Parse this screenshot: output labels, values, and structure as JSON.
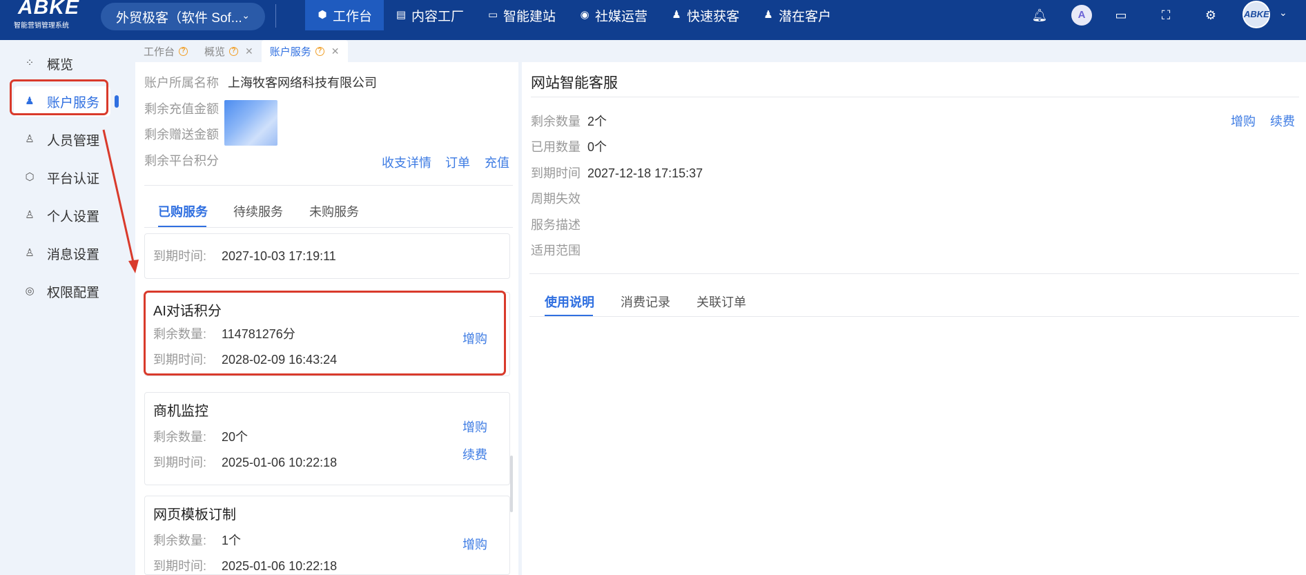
{
  "app": {
    "logo_text": "ABKE",
    "logo_sub": "智能营销管理系统",
    "org_selector": "外贸极客（软件 Sof...",
    "nav": [
      {
        "label": "工作台",
        "icon": "cube-icon",
        "active": true
      },
      {
        "label": "内容工厂",
        "icon": "document-icon"
      },
      {
        "label": "智能建站",
        "icon": "monitor-icon"
      },
      {
        "label": "社媒运营",
        "icon": "chat-bubble-icon"
      },
      {
        "label": "快速获客",
        "icon": "user-icon"
      },
      {
        "label": "潜在客户",
        "icon": "user-plus-icon"
      }
    ],
    "top_icons": [
      "bell-icon",
      "brand-a-icon",
      "folder-icon",
      "fullscreen-icon",
      "gear-icon"
    ],
    "avatar_text": "ABKE"
  },
  "sidebar": {
    "items": [
      {
        "label": "概览",
        "icon": "grid-icon"
      },
      {
        "label": "账户服务",
        "icon": "account-icon",
        "active": true
      },
      {
        "label": "人员管理",
        "icon": "people-icon"
      },
      {
        "label": "平台认证",
        "icon": "verify-icon"
      },
      {
        "label": "个人设置",
        "icon": "user-gear-icon"
      },
      {
        "label": "消息设置",
        "icon": "message-gear-icon"
      },
      {
        "label": "权限配置",
        "icon": "permission-icon"
      }
    ]
  },
  "page_tabs": [
    {
      "label": "工作台",
      "closable": false
    },
    {
      "label": "概览",
      "closable": true
    },
    {
      "label": "账户服务",
      "closable": true,
      "active": true
    }
  ],
  "account": {
    "owner_label": "账户所属名称",
    "owner_value": "上海牧客网络科技有限公司",
    "balance_label": "剩余充值金额",
    "gift_label": "剩余赠送金额",
    "points_label": "剩余平台积分",
    "links": [
      "收支详情",
      "订单",
      "充值"
    ]
  },
  "service_tabs": [
    {
      "label": "已购服务",
      "active": true
    },
    {
      "label": "待续服务"
    },
    {
      "label": "未购服务"
    }
  ],
  "services": [
    {
      "title": "",
      "expiry_label": "到期时间:",
      "expiry": "2027-10-03 17:19:11"
    },
    {
      "title": "AI对话积分",
      "remain_label": "剩余数量:",
      "remain": "114781276分",
      "expiry_label": "到期时间:",
      "expiry": "2028-02-09 16:43:24",
      "links": [
        "增购"
      ]
    },
    {
      "title": "商机监控",
      "remain_label": "剩余数量:",
      "remain": "20个",
      "expiry_label": "到期时间:",
      "expiry": "2025-01-06 10:22:18",
      "links": [
        "增购",
        "续费"
      ]
    },
    {
      "title": "网页模板订制",
      "remain_label": "剩余数量:",
      "remain": "1个",
      "expiry_label": "到期时间:",
      "expiry": "2025-01-06 10:22:18",
      "links": [
        "增购"
      ]
    }
  ],
  "detail": {
    "title": "网站智能客服",
    "links": [
      "增购",
      "续费"
    ],
    "rows": [
      {
        "label": "剩余数量",
        "value": "2个"
      },
      {
        "label": "已用数量",
        "value": "0个"
      },
      {
        "label": "到期时间",
        "value": "2027-12-18 17:15:37"
      },
      {
        "label": "周期失效",
        "value": ""
      },
      {
        "label": "服务描述",
        "value": ""
      },
      {
        "label": "适用范围",
        "value": ""
      }
    ],
    "tabs": [
      {
        "label": "使用说明",
        "active": true
      },
      {
        "label": "消费记录"
      },
      {
        "label": "关联订单"
      }
    ]
  },
  "colors": {
    "topbar": "#103e8f",
    "accent": "#2f6fe0",
    "link": "#3d7be3",
    "highlight": "#d93a2b",
    "tab_help": "#f0a02b"
  }
}
